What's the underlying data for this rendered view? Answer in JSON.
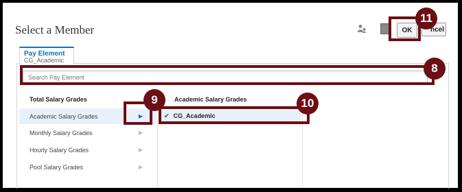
{
  "dialog": {
    "title": "Select a Member",
    "ok_label": "OK",
    "cancel_label": "ncel",
    "person_icon": "person-icon",
    "square_icon": "square-icon"
  },
  "tab": {
    "title": "Pay Element",
    "subtitle": "CG_Academic"
  },
  "search": {
    "placeholder": "Search Pay Element",
    "settings_icon": "gear-icon"
  },
  "left_list": {
    "heading": "Total Salary Grades",
    "items": [
      {
        "label": "Academic Salary Grades",
        "selected": true
      },
      {
        "label": "Monthly Salary Grades",
        "selected": false
      },
      {
        "label": "Hourly Salary Grades",
        "selected": false
      },
      {
        "label": "Pool Salary Grades",
        "selected": false
      }
    ]
  },
  "middle_list": {
    "heading": "Academic Salary Grades",
    "member": "CG_Academic",
    "member_icon": "check-icon"
  },
  "callouts": [
    "8",
    "9",
    "10",
    "11"
  ],
  "colors": {
    "callout": "#6b0f14",
    "accent": "#1a6fb5",
    "selected_bg": "#e8f1fa"
  }
}
